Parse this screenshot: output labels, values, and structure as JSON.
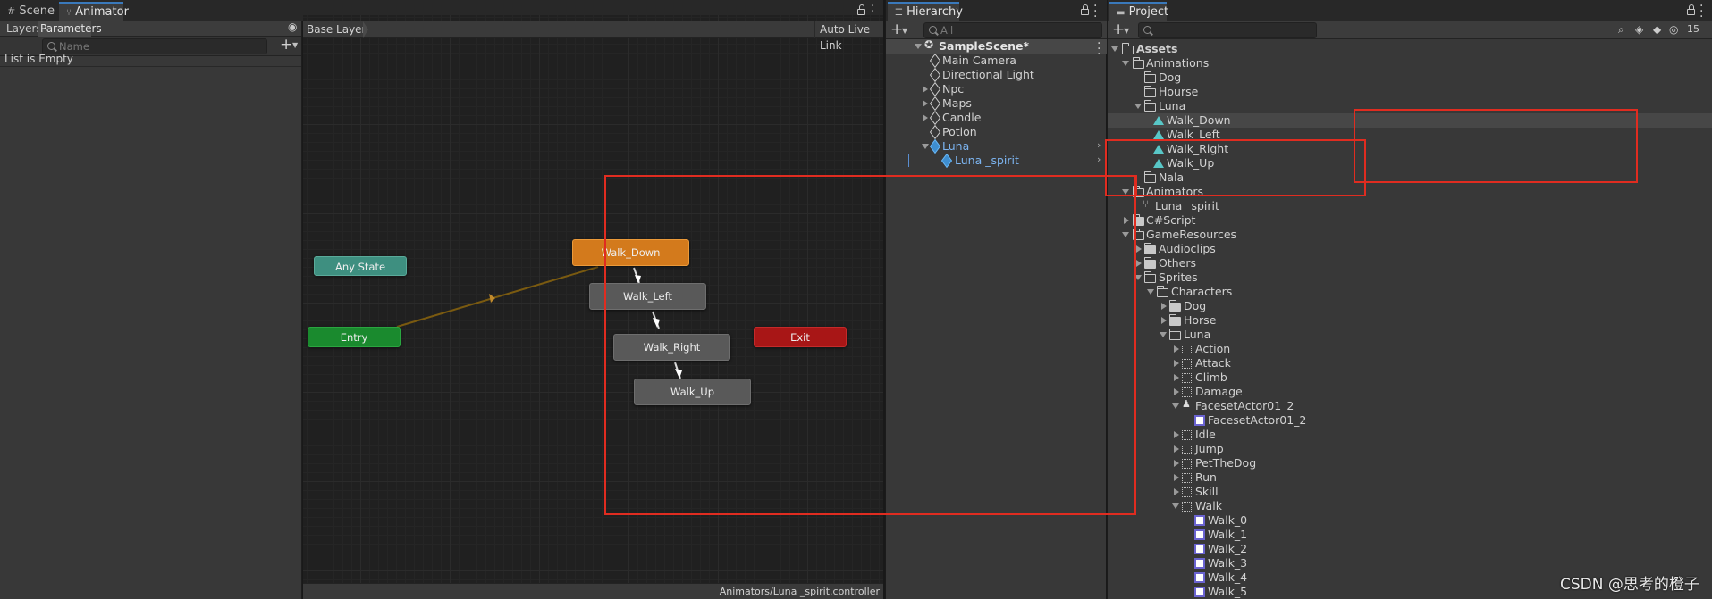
{
  "colors": {
    "accent": "#3a79bb",
    "orange_state": "#d37a1c",
    "entry": "#1a8a2e",
    "any_state": "#3f8f7f",
    "exit": "#b01515",
    "state_gray": "#5a5a5a",
    "annotation": "#e02c20"
  },
  "animator": {
    "tabs": [
      {
        "label": "Scene",
        "icon": "grid-icon"
      },
      {
        "label": "Animator",
        "icon": "animator-icon"
      }
    ],
    "subtabs": [
      "Layers",
      "Parameters"
    ],
    "search_placeholder": "Name",
    "list_empty": "List is Empty",
    "breadcrumb": "Base Layer",
    "auto_live_link": "Auto Live Link",
    "states": {
      "any_state": "Any State",
      "entry": "Entry",
      "exit": "Exit",
      "walk_down": "Walk_Down",
      "walk_left": "Walk_Left",
      "walk_right": "Walk_Right",
      "walk_up": "Walk_Up"
    },
    "footer_path": "Animators/Luna _spirit.controller"
  },
  "hierarchy": {
    "tab": "Hierarchy",
    "search_placeholder": "All",
    "scene": "SampleScene*",
    "items": [
      "Main Camera",
      "Directional Light",
      "Npc",
      "Maps",
      "Candle",
      "Potion",
      "Luna",
      "Luna _spirit"
    ]
  },
  "project": {
    "tab": "Project",
    "badge": "15",
    "items": [
      "Assets",
      "Animations",
      "Dog",
      "Hourse",
      "Luna",
      "Walk_Down",
      "Walk_Left",
      "Walk_Right",
      "Walk_Up",
      "Nala",
      "Animators",
      "Luna _spirit",
      "C#Script",
      "GameResources",
      "Audioclips",
      "Others",
      "Sprites",
      "Characters",
      "Dog",
      "Horse",
      "Luna",
      "Action",
      "Attack",
      "Climb",
      "Damage",
      "FacesetActor01_2",
      "FacesetActor01_2",
      "Idle",
      "Jump",
      "PetTheDog",
      "Run",
      "Skill",
      "Walk",
      "Walk_0",
      "Walk_1",
      "Walk_2",
      "Walk_3",
      "Walk_4",
      "Walk_5"
    ]
  },
  "watermark": "CSDN @思考的橙子"
}
